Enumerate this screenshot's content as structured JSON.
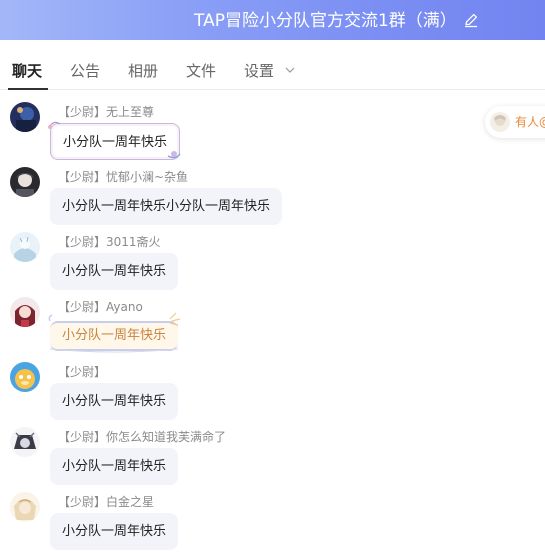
{
  "header": {
    "title": "TAP冒险小分队官方交流1群（满）"
  },
  "tabs": [
    {
      "label": "聊天",
      "active": true
    },
    {
      "label": "公告"
    },
    {
      "label": "相册"
    },
    {
      "label": "文件"
    },
    {
      "label": "设置"
    }
  ],
  "side_notice": {
    "text": "有人@"
  },
  "messages": [
    {
      "sender": "【少尉】无上至尊",
      "text": "小分队一周年快乐"
    },
    {
      "sender": "【少尉】忧郁小澜~杂鱼",
      "text": "小分队一周年快乐小分队一周年快乐"
    },
    {
      "sender": "【少尉】3011斋火",
      "text": "小分队一周年快乐"
    },
    {
      "sender": "【少尉】Ayano",
      "text": "小分队一周年快乐"
    },
    {
      "sender": "【少尉】",
      "text": "小分队一周年快乐"
    },
    {
      "sender": "【少尉】你怎么知道我芙满命了",
      "text": "小分队一周年快乐"
    },
    {
      "sender": "【少尉】白金之星",
      "text": "小分队一周年快乐"
    }
  ],
  "icons": {
    "edit": "edit-icon",
    "dropdown": "chevron-down-icon"
  },
  "colors": {
    "header_gradient_start": "#a3b7f8",
    "header_gradient_end": "#7284f0",
    "bubble_bg": "#f2f4fa",
    "mention_text": "#e88a3a"
  }
}
